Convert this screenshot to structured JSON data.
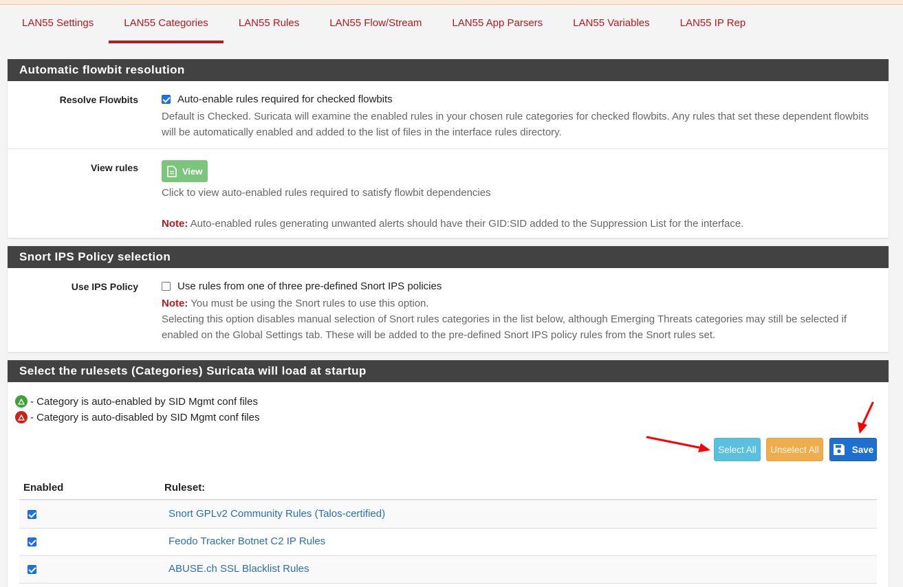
{
  "tabs": [
    {
      "label": "LAN55 Settings",
      "active": false
    },
    {
      "label": "LAN55 Categories",
      "active": true
    },
    {
      "label": "LAN55 Rules",
      "active": false
    },
    {
      "label": "LAN55 Flow/Stream",
      "active": false
    },
    {
      "label": "LAN55 App Parsers",
      "active": false
    },
    {
      "label": "LAN55 Variables",
      "active": false
    },
    {
      "label": "LAN55 IP Rep",
      "active": false
    }
  ],
  "flowbit": {
    "heading": "Automatic flowbit resolution",
    "resolve_label": "Resolve Flowbits",
    "resolve_checked": true,
    "resolve_checkbox_text": "Auto-enable rules required for checked flowbits",
    "resolve_help": "Default is Checked. Suricata will examine the enabled rules in your chosen rule categories for checked flowbits. Any rules that set these dependent flowbits will be automatically enabled and added to the list of files in the interface rules directory.",
    "view_label": "View rules",
    "view_button": "View",
    "view_help": "Click to view auto-enabled rules required to satisfy flowbit dependencies",
    "note_label": "Note:",
    "note_text": "Auto-enabled rules generating unwanted alerts should have their GID:SID added to the Suppression List for the interface."
  },
  "ips": {
    "heading": "Snort IPS Policy selection",
    "label": "Use IPS Policy",
    "checked": false,
    "checkbox_text": "Use rules from one of three pre-defined Snort IPS policies",
    "note_label": "Note:",
    "note_text": "You must be using the Snort rules to use this option.",
    "help": "Selecting this option disables manual selection of Snort rules categories in the list below, although Emerging Threats categories may still be selected if enabled on the Global Settings tab. These will be added to the pre-defined Snort IPS policy rules from the Snort rules set."
  },
  "rulesets": {
    "heading": "Select the rulesets (Categories) Suricata will load at startup",
    "legend_enabled": "- Category is auto-enabled by SID Mgmt conf files",
    "legend_disabled": "- Category is auto-disabled by SID Mgmt conf files",
    "btn_select_all": "Select All",
    "btn_unselect_all": "Unselect All",
    "btn_save": "Save",
    "col_enabled": "Enabled",
    "col_ruleset": "Ruleset:",
    "rows": [
      {
        "name": "Snort GPLv2 Community Rules (Talos-certified)",
        "enabled": true
      },
      {
        "name": "Feodo Tracker Botnet C2 IP Rules",
        "enabled": true
      },
      {
        "name": "ABUSE.ch SSL Blacklist Rules",
        "enabled": true
      }
    ]
  },
  "colors": {
    "tab_text": "#b8191f",
    "panel_heading": "#424242",
    "view_button": "#7cc57d",
    "select_all": "#5bc0de",
    "unselect_all": "#f0ad4e",
    "save": "#1e6fd0",
    "link": "#2a6fb1",
    "annotation_arrow": "#ff0000"
  }
}
